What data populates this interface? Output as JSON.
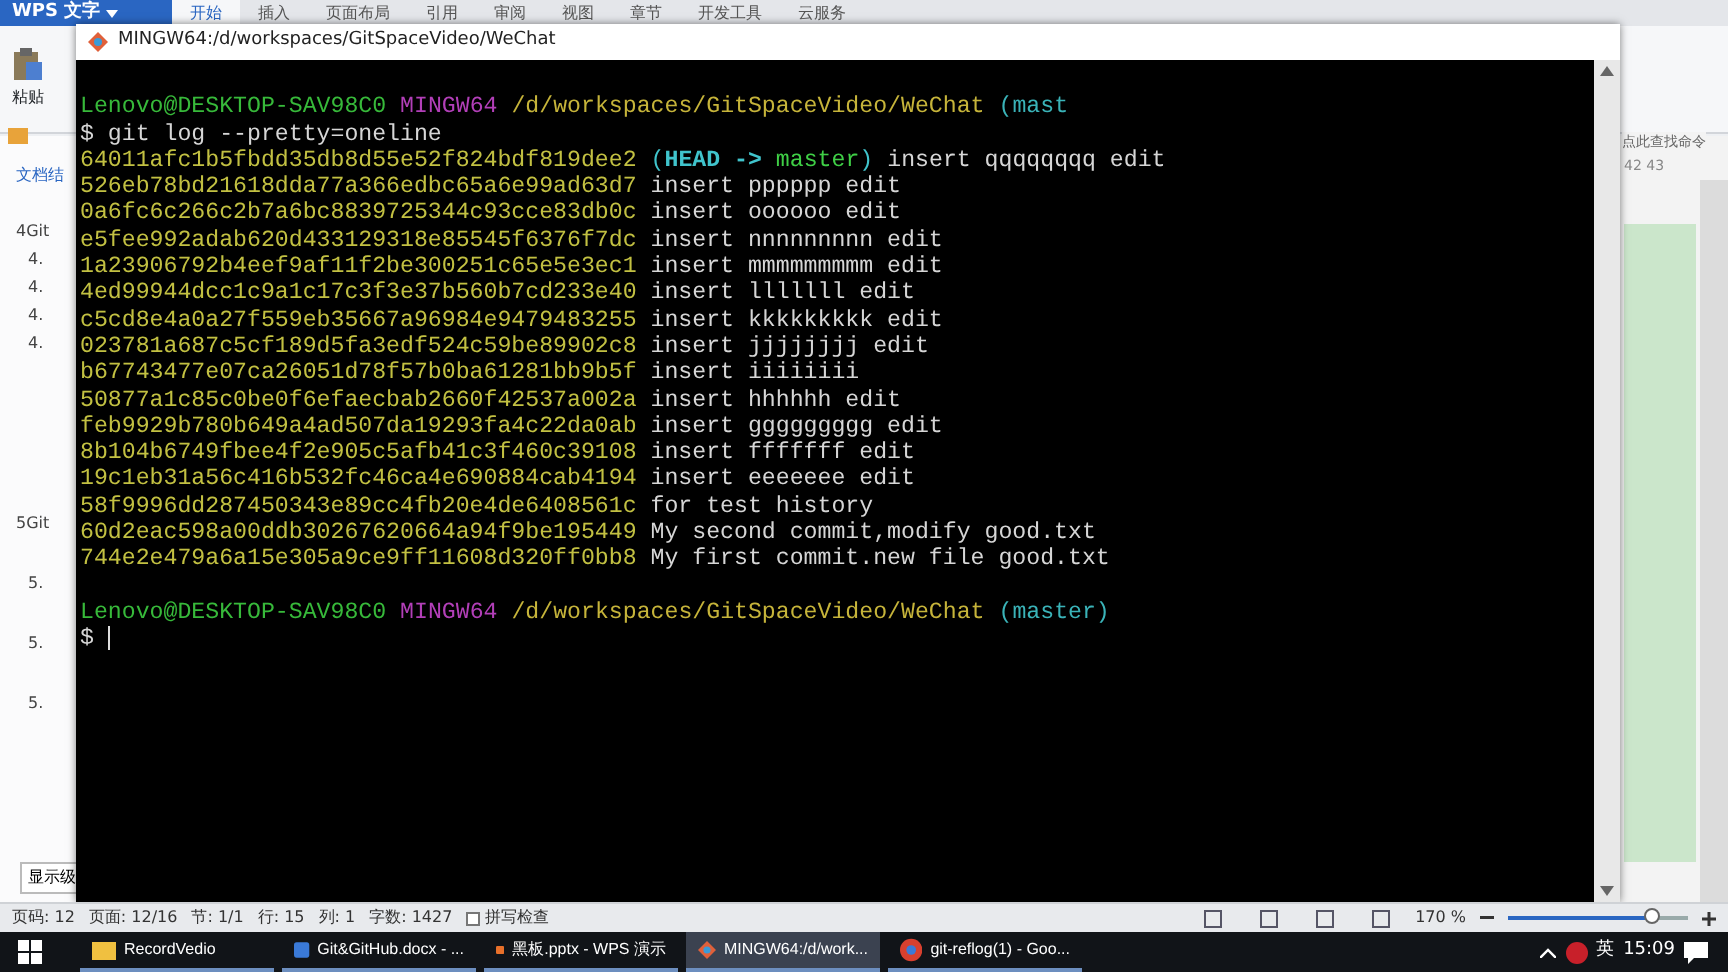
{
  "wps": {
    "app_button": "WPS 文字",
    "tabs": [
      {
        "label": "开始",
        "selected": true
      },
      {
        "label": "插入",
        "selected": false
      },
      {
        "label": "页面布局",
        "selected": false
      },
      {
        "label": "引用",
        "selected": false
      },
      {
        "label": "审阅",
        "selected": false
      },
      {
        "label": "视图",
        "selected": false
      },
      {
        "label": "章节",
        "selected": false
      },
      {
        "label": "开发工具",
        "selected": false
      },
      {
        "label": "云服务",
        "selected": false
      }
    ],
    "paste_label": "粘贴",
    "pane_title": "文档结",
    "outline": [
      "4Git",
      "4.",
      "4.",
      "4.",
      "4.",
      "5Git",
      "5.",
      "5.",
      "5."
    ],
    "level_button": "显示级",
    "find_hint": "点此查找命令",
    "ruler": [
      "42",
      "43"
    ]
  },
  "terminal": {
    "title": "MINGW64:/d/workspaces/GitSpaceVideo/WeChat",
    "prompt": {
      "user": "Lenovo@DESKTOP-SAV98C0",
      "system": "MINGW64",
      "path": "/d/workspaces/GitSpaceVideo/WeChat",
      "branch": "(mast"
    },
    "command": "$ git log --pretty=oneline",
    "commits": [
      {
        "hash": "64011afc1b5fbdd35db8d55e52f824bdf819dee2",
        "decoration": [
          {
            "text": "(",
            "kind": "paren"
          },
          {
            "text": "HEAD",
            "kind": "head"
          },
          {
            "text": " -> ",
            "kind": "arrow"
          },
          {
            "text": "master",
            "kind": "branch"
          },
          {
            "text": ")",
            "kind": "paren"
          }
        ],
        "message": "insert qqqqqqqq edit"
      },
      {
        "hash": "526eb78bd21618dda77a366edbc65a6e99ad63d7",
        "message": "insert pppppp edit"
      },
      {
        "hash": "0a6fc6c266c2b7a6bc8839725344c93cce83db0c",
        "message": "insert oooooo edit"
      },
      {
        "hash": "e5fee992adab620d433129318e85545f6376f7dc",
        "message": "insert nnnnnnnnn edit"
      },
      {
        "hash": "1a23906792b4eef9af11f2be300251c65e5e3ec1",
        "message": "insert mmmmmmmmm edit"
      },
      {
        "hash": "4ed99944dcc1c9a1c17c3f3e37b560b7cd233e40",
        "message": "insert lllllll edit"
      },
      {
        "hash": "c5cd8e4a0a27f559eb35667a96984e9479483255",
        "message": "insert kkkkkkkkk edit"
      },
      {
        "hash": "023781a687c5cf189d5fa3edf524c59be89902c8",
        "message": "insert jjjjjjjj edit"
      },
      {
        "hash": "b67743477e07ca26051d78f57b0ba61281bb9b5f",
        "message": "insert iiiiiiii"
      },
      {
        "hash": "50877a1c85c0be0f6efaecbab2660f42537a002a",
        "message": "insert hhhhhh edit"
      },
      {
        "hash": "feb9929b780b649a4ad507da19293fa4c22da0ab",
        "message": "insert ggggggggg edit"
      },
      {
        "hash": "8b104b6749fbee4f2e905c5afb41c3f460c39108",
        "message": "insert fffffff edit"
      },
      {
        "hash": "19c1eb31a56c416b532fc46ca4e690884cab4194",
        "message": "insert eeeeeee edit"
      },
      {
        "hash": "58f9996dd287450343e89cc4fb20e4de6408561c",
        "message": "for test history"
      },
      {
        "hash": "60d2eac598a00ddb30267620664a94f9be195449",
        "message": "My second commit,modify good.txt"
      },
      {
        "hash": "744e2e479a6a15e305a9ce9ff11608d320ff0bb8",
        "message": "My first commit.new file good.txt"
      }
    ],
    "prompt2": {
      "user": "Lenovo@DESKTOP-SAV98C0",
      "system": "MINGW64",
      "path": "/d/workspaces/GitSpaceVideo/WeChat",
      "branch": "(master)"
    },
    "input_line": "$"
  },
  "status_bar": {
    "items": [
      "页码: 12",
      "页面: 12/16",
      "节: 1/1",
      "行: 15",
      "列: 1",
      "字数: 1427"
    ],
    "spell_check": {
      "label": "拼写检查",
      "checked": false
    },
    "zoom": "170 %",
    "zoom_slider": {
      "level": 0.8
    }
  },
  "taskbar": {
    "items": [
      {
        "label": "RecordVedio",
        "kind": "folder",
        "selected": false
      },
      {
        "label": "Git&GitHub.docx - ...",
        "kind": "writer",
        "selected": false
      },
      {
        "label": "黑板.pptx - WPS 演示",
        "kind": "slides",
        "selected": false
      },
      {
        "label": "MINGW64:/d/work...",
        "kind": "git",
        "selected": true
      },
      {
        "label": "git-reflog(1) - Goo...",
        "kind": "browser",
        "selected": false
      }
    ],
    "ime": "英",
    "clock": "15:09"
  }
}
